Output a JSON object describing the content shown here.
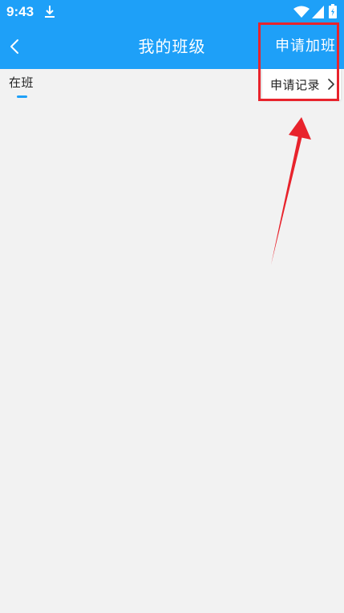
{
  "status_bar": {
    "time": "9:43",
    "icons": [
      "download-icon",
      "wifi-icon",
      "signal-icon",
      "battery-icon"
    ]
  },
  "app_bar": {
    "back_icon": "chevron-left-icon",
    "title": "我的班级",
    "action_label": "申请加班"
  },
  "tabs": [
    {
      "label": "在班",
      "selected": true
    }
  ],
  "dropdown": {
    "items": [
      {
        "label": "申请记录",
        "icon": "chevron-right-icon"
      }
    ]
  },
  "colors": {
    "primary": "#1ea0f8",
    "background": "#f2f2f2",
    "annotation": "#e8232c",
    "text": "#222222"
  }
}
